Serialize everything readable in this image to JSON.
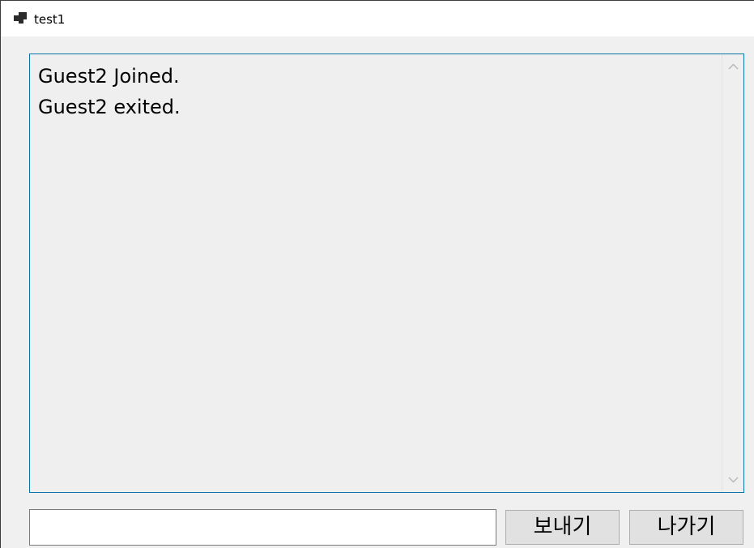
{
  "window": {
    "title": "test1"
  },
  "log": {
    "lines": [
      "Guest2 Joined.",
      "Guest2 exited."
    ]
  },
  "message_input": {
    "value": "",
    "placeholder": ""
  },
  "buttons": {
    "send_label": "보내기",
    "exit_label": "나가기"
  },
  "colors": {
    "log_border": "#0a74a8",
    "background": "#f0f0f0",
    "button_bg": "#e1e1e1"
  }
}
